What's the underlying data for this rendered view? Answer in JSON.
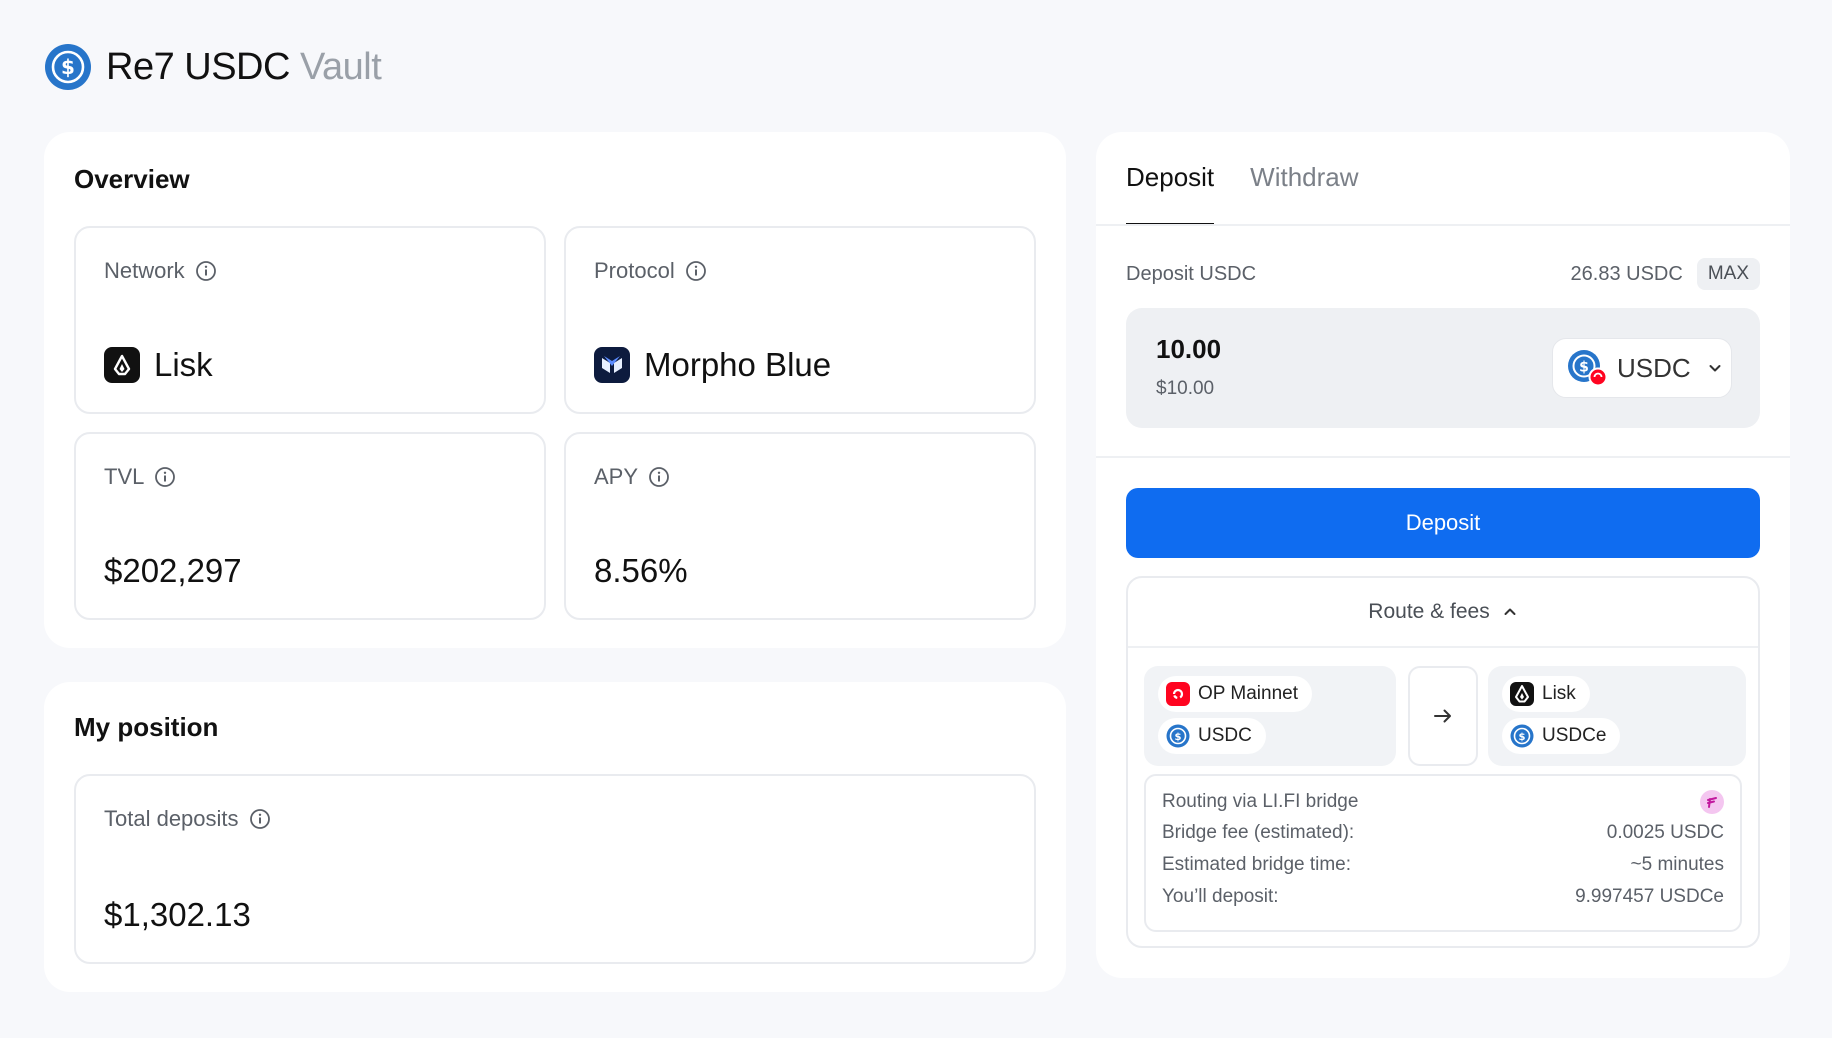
{
  "header": {
    "title_main": "Re7 USDC",
    "title_sub": "Vault",
    "icon": "usdc-icon",
    "accent": "#2775ca"
  },
  "overview": {
    "title": "Overview",
    "network": {
      "label": "Network",
      "value": "Lisk",
      "icon": "lisk-icon"
    },
    "protocol": {
      "label": "Protocol",
      "value": "Morpho Blue",
      "icon": "morpho-icon"
    },
    "tvl": {
      "label": "TVL",
      "value": "$202,297"
    },
    "apy": {
      "label": "APY",
      "value": "8.56%"
    }
  },
  "position": {
    "title": "My position",
    "total_deposits": {
      "label": "Total deposits",
      "value": "$1,302.13"
    }
  },
  "panel": {
    "tabs": [
      "Deposit",
      "Withdraw"
    ],
    "active_tab": "Deposit",
    "deposit_label": "Deposit USDC",
    "balance": "26.83 USDC",
    "max_label": "MAX",
    "amount": "10.00",
    "amount_usd": "$10.00",
    "token": "USDC",
    "deposit_button": "Deposit",
    "primary_color": "#0f6cf0",
    "route": {
      "header": "Route & fees",
      "from": {
        "chain": "OP Mainnet",
        "token": "USDC"
      },
      "to": {
        "chain": "Lisk",
        "token": "USDCe"
      },
      "rows": [
        {
          "label": "Routing via LI.FI bridge",
          "value": ""
        },
        {
          "label": "Bridge fee (estimated):",
          "value": "0.0025 USDC"
        },
        {
          "label": "Estimated bridge time:",
          "value": "~5 minutes"
        },
        {
          "label": "You’ll deposit:",
          "value": "9.997457 USDCe"
        }
      ]
    }
  }
}
